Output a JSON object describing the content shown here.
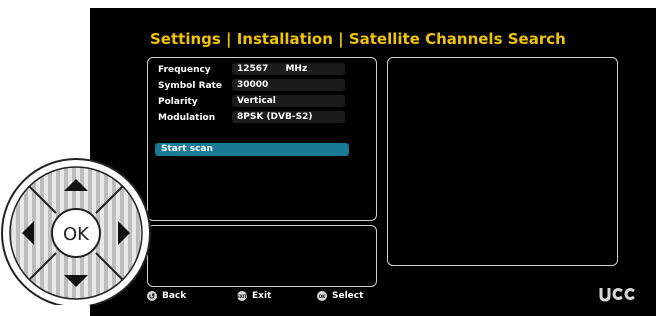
{
  "header": {
    "title": "Settings | Installation | Satellite Channels Search"
  },
  "params": [
    {
      "label": "Frequency",
      "value": "12567",
      "unit": "MHz"
    },
    {
      "label": "Symbol Rate",
      "value": "30000"
    },
    {
      "label": "Polarity",
      "value": "Vertical"
    },
    {
      "label": "Modulation",
      "value": "8PSK (DVB-S2)"
    }
  ],
  "start_scan_label": "Start scan",
  "footer": {
    "back": "Back",
    "exit": "Exit",
    "select": "Select",
    "exit_icon": "EXIT",
    "select_icon": "OK"
  },
  "dpad": {
    "ok_label": "OK"
  },
  "colors": {
    "title": "#f0c400",
    "highlight": "#1a7a96",
    "background": "#000000"
  }
}
